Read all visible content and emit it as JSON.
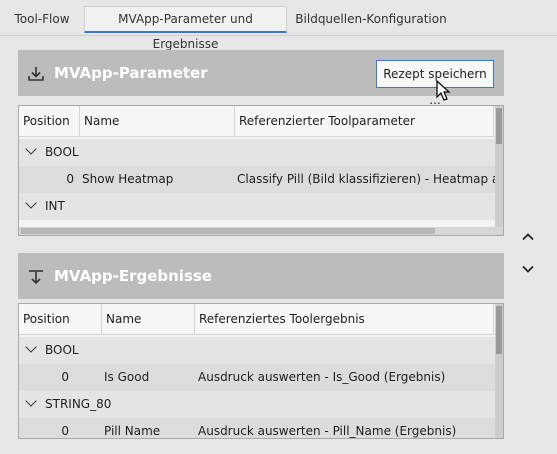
{
  "tabs": [
    {
      "label": "Tool-Flow",
      "active": false
    },
    {
      "label": "MVApp-Parameter und Ergebnisse",
      "active": true
    },
    {
      "label": "Bildquellen-Konfiguration",
      "active": false
    }
  ],
  "parameters": {
    "title": "MVApp-Parameter",
    "icon": "download-icon",
    "save_button": "Rezept speichern ...",
    "columns": [
      "Position",
      "Name",
      "Referenzierter Toolparameter"
    ],
    "groups": [
      {
        "label": "BOOL",
        "rows": [
          {
            "position": "0",
            "name": "Show Heatmap",
            "reference": "Classify Pill (Bild klassifizieren) - Heatmap anzeigen"
          }
        ]
      },
      {
        "label": "INT",
        "rows": []
      }
    ]
  },
  "results": {
    "title": "MVApp-Ergebnisse",
    "icon": "upload-icon",
    "columns": [
      "Position",
      "Name",
      "Referenziertes Toolergebnis"
    ],
    "groups": [
      {
        "label": "BOOL",
        "rows": [
          {
            "position": "0",
            "name": "Is Good",
            "reference": "Ausdruck auswerten - Is_Good (Ergebnis)"
          }
        ]
      },
      {
        "label": "STRING_80",
        "rows": [
          {
            "position": "0",
            "name": "Pill Name",
            "reference": "Ausdruck auswerten - Pill_Name (Ergebnis)"
          }
        ]
      }
    ]
  },
  "side_nav": {
    "up_icon": "chevron-up-icon",
    "down_icon": "chevron-down-icon"
  },
  "colors": {
    "accent": "#3a78c8",
    "header_bg": "#bcbcbc",
    "group_bg": "#e4e4e4",
    "row_bg": "#dcdcdc"
  }
}
